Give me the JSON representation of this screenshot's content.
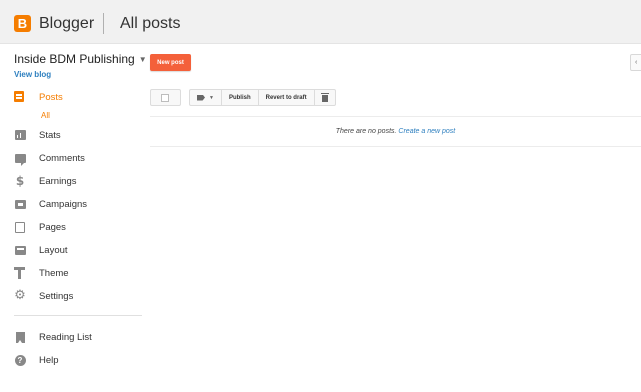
{
  "header": {
    "logo_letter": "B",
    "brand": "Blogger",
    "title": "All posts"
  },
  "blog": {
    "name": "Inside BDM Publishing",
    "view_blog": "View blog"
  },
  "sidebar": {
    "items": [
      {
        "label": "Posts",
        "icon": "posts-icon",
        "active": true
      },
      {
        "label": "All",
        "sub": true
      },
      {
        "label": "Stats",
        "icon": "stats-icon"
      },
      {
        "label": "Comments",
        "icon": "comments-icon"
      },
      {
        "label": "Earnings",
        "icon": "dollar-icon"
      },
      {
        "label": "Campaigns",
        "icon": "campaigns-icon"
      },
      {
        "label": "Pages",
        "icon": "pages-icon"
      },
      {
        "label": "Layout",
        "icon": "layout-icon"
      },
      {
        "label": "Theme",
        "icon": "theme-icon"
      },
      {
        "label": "Settings",
        "icon": "gear-icon"
      }
    ],
    "secondary": [
      {
        "label": "Reading List",
        "icon": "bookmark-icon"
      },
      {
        "label": "Help",
        "icon": "help-icon"
      }
    ]
  },
  "toolbar": {
    "new_post": "New post",
    "publish": "Publish",
    "revert": "Revert to draft"
  },
  "main": {
    "empty_text": "There are no posts.",
    "create_link": "Create a new post"
  },
  "colors": {
    "accent": "#f57d00",
    "new_post_button": "#f4603a",
    "link": "#2d7fbf"
  }
}
